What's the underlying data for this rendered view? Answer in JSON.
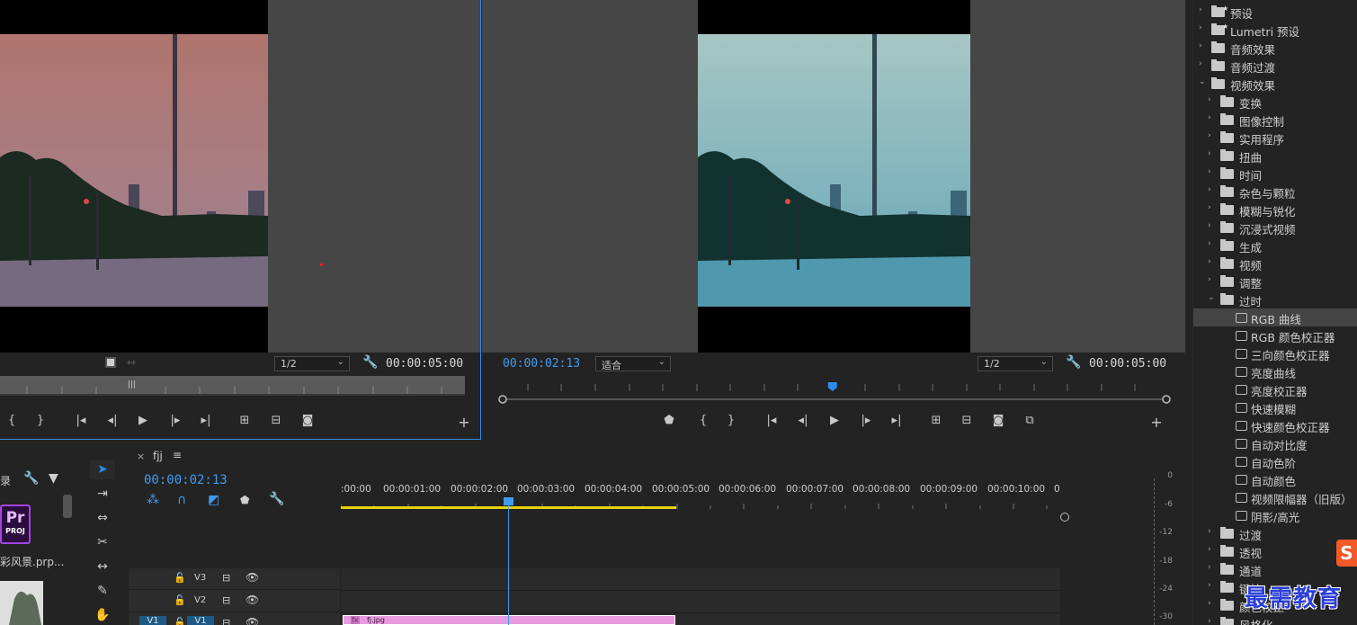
{
  "source_monitor": {
    "zoom": "1/2",
    "duration": "00:00:05:00"
  },
  "program_monitor": {
    "current_time": "00:00:02:13",
    "fit": "适合",
    "zoom": "1/2",
    "duration": "00:00:05:00",
    "playhead_fraction": 0.497
  },
  "effects": {
    "items": [
      {
        "label": "预设",
        "level": 0,
        "type": "folder-star"
      },
      {
        "label": "Lumetri 预设",
        "level": 0,
        "type": "folder-star"
      },
      {
        "label": "音频效果",
        "level": 0,
        "type": "folder"
      },
      {
        "label": "音频过渡",
        "level": 0,
        "type": "folder"
      },
      {
        "label": "视频效果",
        "level": 0,
        "type": "folder",
        "open": true
      },
      {
        "label": "变换",
        "level": 1,
        "type": "folder"
      },
      {
        "label": "图像控制",
        "level": 1,
        "type": "folder"
      },
      {
        "label": "实用程序",
        "level": 1,
        "type": "folder"
      },
      {
        "label": "扭曲",
        "level": 1,
        "type": "folder"
      },
      {
        "label": "时间",
        "level": 1,
        "type": "folder"
      },
      {
        "label": "杂色与颗粒",
        "level": 1,
        "type": "folder"
      },
      {
        "label": "模糊与锐化",
        "level": 1,
        "type": "folder"
      },
      {
        "label": "沉浸式视频",
        "level": 1,
        "type": "folder"
      },
      {
        "label": "生成",
        "level": 1,
        "type": "folder"
      },
      {
        "label": "视频",
        "level": 1,
        "type": "folder"
      },
      {
        "label": "调整",
        "level": 1,
        "type": "folder"
      },
      {
        "label": "过时",
        "level": 1,
        "type": "folder",
        "open": true
      },
      {
        "label": "RGB 曲线",
        "level": 2,
        "type": "effect",
        "selected": true
      },
      {
        "label": "RGB 颜色校正器",
        "level": 2,
        "type": "effect"
      },
      {
        "label": "三向颜色校正器",
        "level": 2,
        "type": "effect"
      },
      {
        "label": "亮度曲线",
        "level": 2,
        "type": "effect"
      },
      {
        "label": "亮度校正器",
        "level": 2,
        "type": "effect"
      },
      {
        "label": "快速模糊",
        "level": 2,
        "type": "effect"
      },
      {
        "label": "快速颜色校正器",
        "level": 2,
        "type": "effect"
      },
      {
        "label": "自动对比度",
        "level": 2,
        "type": "effect"
      },
      {
        "label": "自动色阶",
        "level": 2,
        "type": "effect"
      },
      {
        "label": "自动颜色",
        "level": 2,
        "type": "effect"
      },
      {
        "label": "视频限幅器（旧版）",
        "level": 2,
        "type": "effect"
      },
      {
        "label": "阴影/高光",
        "level": 2,
        "type": "effect"
      },
      {
        "label": "过渡",
        "level": 1,
        "type": "folder"
      },
      {
        "label": "透视",
        "level": 1,
        "type": "folder"
      },
      {
        "label": "通道",
        "level": 1,
        "type": "folder"
      },
      {
        "label": "键控",
        "level": 1,
        "type": "folder"
      },
      {
        "label": "颜色校正",
        "level": 1,
        "type": "folder"
      },
      {
        "label": "风格化",
        "level": 1,
        "type": "folder"
      }
    ]
  },
  "project": {
    "header_fragment": "录",
    "file_badge": "Pr",
    "file_badge_sub": "PROJ",
    "file_name": "彩风景.prp..."
  },
  "timeline": {
    "sequence_name": "fjj",
    "current_time": "00:00:02:13",
    "ruler_labels": [
      ":00:00",
      "00:00:01:00",
      "00:00:02:00",
      "00:00:03:00",
      "00:00:04:00",
      "00:00:05:00",
      "00:00:06:00",
      "00:00:07:00",
      "00:00:08:00",
      "00:00:09:00",
      "00:00:10:00",
      "0"
    ],
    "tracks": [
      {
        "name": "V3",
        "source": ""
      },
      {
        "name": "V2",
        "source": ""
      },
      {
        "name": "V1",
        "source": "V1"
      }
    ],
    "clip_name": "fj.jpg",
    "clip_fx": "fx"
  },
  "meter": {
    "labels": [
      "0",
      "-6",
      "-12",
      "-18",
      "-24",
      "-30"
    ]
  },
  "watermark": {
    "text": "最需教育",
    "logo": "S"
  },
  "colors": {
    "accent": "#2d8ceb",
    "timecode_blue": "#3f9bf0",
    "work_area": "#e8d100",
    "clip_pink": "#e79ce0"
  }
}
